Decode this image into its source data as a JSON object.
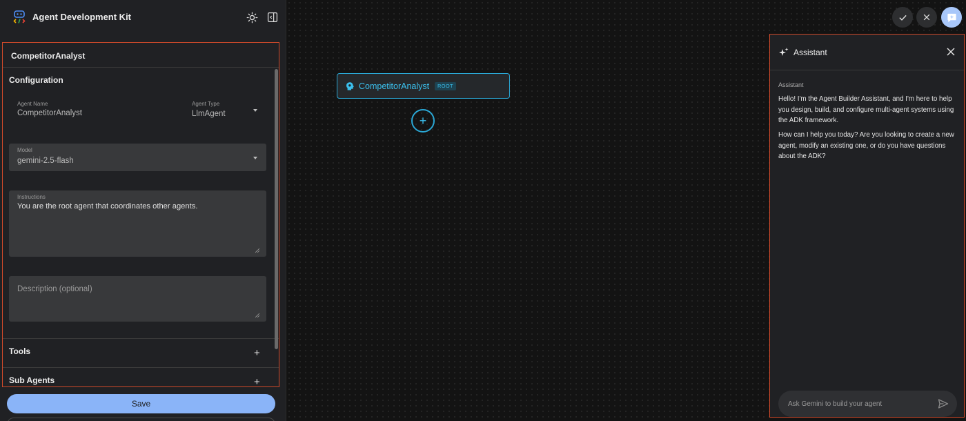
{
  "app": {
    "title": "Agent Development Kit"
  },
  "panel": {
    "title": "CompetitorAnalyst",
    "configuration": {
      "heading": "Configuration",
      "agent_name": {
        "label": "Agent Name",
        "value": "CompetitorAnalyst"
      },
      "agent_type": {
        "label": "Agent Type",
        "value": "LlmAgent"
      },
      "model": {
        "label": "Model",
        "value": "gemini-2.5-flash"
      },
      "instructions": {
        "label": "Instructions",
        "value": "You are the root agent that coordinates other agents."
      },
      "description": {
        "placeholder": "Description (optional)",
        "value": ""
      }
    },
    "tools": {
      "heading": "Tools",
      "add": "+"
    },
    "sub_agents": {
      "heading": "Sub Agents",
      "add": "+"
    },
    "scroll_thumb_fraction": 0.88
  },
  "footer": {
    "save_label": "Save"
  },
  "canvas": {
    "node": {
      "name": "CompetitorAnalyst",
      "badge": "ROOT",
      "icon": "brain-icon"
    },
    "add_label": "+"
  },
  "toolbar": {
    "confirm_icon": "check-icon",
    "cancel_icon": "close-icon",
    "assistant_icon": "assistant-icon"
  },
  "assistant": {
    "title": "Assistant",
    "author": "Assistant",
    "messages": [
      "Hello! I'm the Agent Builder Assistant, and I'm here to help you design, build, and configure multi-agent systems using the ADK framework.",
      "How can I help you today? Are you looking to create a new agent, modify an existing one, or do you have questions about the ADK?"
    ],
    "input_placeholder": "Ask Gemini to build your agent"
  },
  "colors": {
    "accent_blue": "#8ab4f8",
    "node_cyan": "#3bc0ee",
    "highlight_border": "#d24a2a",
    "background": "#131313"
  }
}
